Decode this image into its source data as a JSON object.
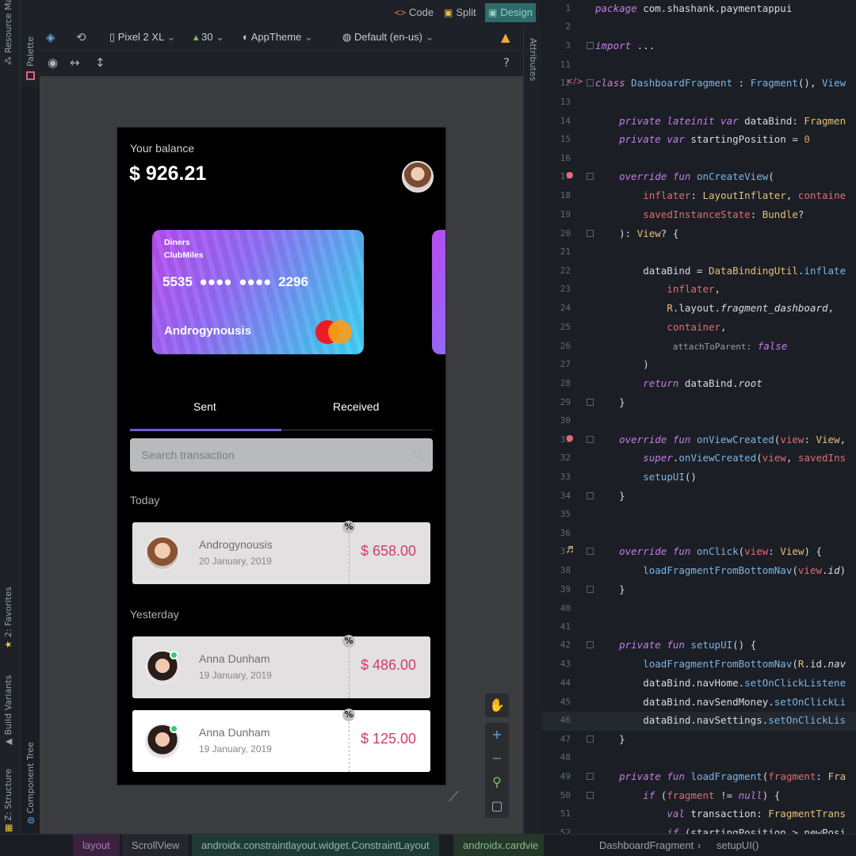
{
  "side_tabs": {
    "resource_manager": "Resource Ma",
    "palette": "Palette",
    "favorites": "2: Favorites",
    "build_variants": "Build Variants",
    "structure": "Z: Structure",
    "component_tree": "Component Tree",
    "attributes": "Attributes"
  },
  "mode_bar": {
    "code": "Code",
    "split": "Split",
    "design": "Design"
  },
  "toolbar": {
    "device": "Pixel 2 XL",
    "api": "30",
    "theme": "AppTheme",
    "locale": "Default (en-us)"
  },
  "app": {
    "balance_label": "Your balance",
    "balance_value": "$ 926.21",
    "card": {
      "bank_line1": "Diners",
      "bank_line2": "ClubMiles",
      "number": "5535  ●●●●  ●●●●  2296",
      "holder": "Androgynousis"
    },
    "tabs": [
      "Sent",
      "Received"
    ],
    "search_placeholder": "Search transaction",
    "sections": [
      "Today",
      "Yesterday"
    ],
    "transactions": [
      {
        "name": "Androgynousis",
        "date": "20 January, 2019",
        "amount": "$ 658.00",
        "badge": "%"
      },
      {
        "name": "Anna Dunham",
        "date": "19 January, 2019",
        "amount": "$ 486.00",
        "badge": "%"
      },
      {
        "name": "Anna Dunham",
        "date": "19 January, 2019",
        "amount": "$ 125.00",
        "badge": "%"
      }
    ]
  },
  "editor": {
    "line_numbers": [
      "1",
      "2",
      "3",
      "11",
      "12",
      "13",
      "14",
      "15",
      "16",
      "17",
      "18",
      "19",
      "20",
      "21",
      "22",
      "23",
      "24",
      "25",
      "26",
      "27",
      "28",
      "29",
      "30",
      "31",
      "32",
      "33",
      "34",
      "35",
      "36",
      "37",
      "38",
      "39",
      "40",
      "41",
      "42",
      "43",
      "44",
      "45",
      "46",
      "47",
      "48",
      "49",
      "50",
      "51",
      "52"
    ]
  },
  "breadcrumb": [
    "layout",
    "ScrollView",
    "androidx.constraintlayout.widget.ConstraintLayout",
    "androidx.cardvie",
    "DashboardFragment",
    "setupUI()"
  ],
  "colors": {
    "accent": "#6e5bd4",
    "amount": "#d63a6e",
    "online": "#2ecc71"
  }
}
